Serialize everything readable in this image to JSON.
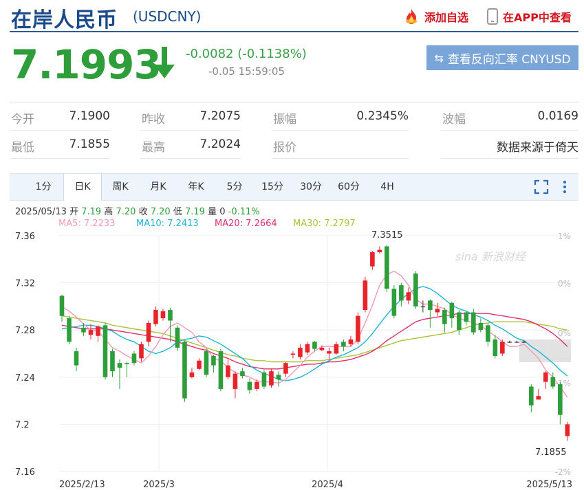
{
  "header": {
    "title": "在岸人民币",
    "symbol": "(USDCNY)",
    "add_watch": "添加自选",
    "app_view": "在APP中查看"
  },
  "quote": {
    "price": "7.1993",
    "change": "-0.0082 (-0.1138%)",
    "time": "-0.05 15:59:05",
    "reverse_button": "查看反向汇率 CNYUSD",
    "down_color": "#2e9e3a",
    "up_color": "#e8232a"
  },
  "stats": {
    "open_label": "今开",
    "open": "7.1900",
    "prev_close_label": "昨收",
    "prev_close": "7.2075",
    "amplitude_label": "振幅",
    "amplitude": "0.2345%",
    "volatility_label": "波幅",
    "volatility": "0.0169",
    "low_label": "最低",
    "low": "7.1855",
    "high_label": "最高",
    "high": "7.2024",
    "quote_label": "报价",
    "quote_val": "",
    "source": "数据来源于倚天"
  },
  "tabs": [
    "1分",
    "日K",
    "周K",
    "月K",
    "年K",
    "5分",
    "15分",
    "30分",
    "60分",
    "4H"
  ],
  "active_tab": "日K",
  "chart_info": {
    "date": "2025/05/13",
    "open_label": "开",
    "open": "7.19",
    "high_label": "高",
    "high": "7.20",
    "close_label": "收",
    "close": "7.20",
    "low_label": "低",
    "low": "7.19",
    "vol_label": "量",
    "vol": "0",
    "pct": "-0.11%",
    "ma5": "MA5: 7.2233",
    "ma10": "MA10: 7.2413",
    "ma20": "MA20: 7.2664",
    "ma30": "MA30: 7.2797",
    "ma5_color": "#f29bb5",
    "ma10_color": "#1eb3d6",
    "ma20_color": "#e0306a",
    "ma30_color": "#a8c23a"
  },
  "watermark": "新浪财经",
  "chart_data": {
    "type": "candlestick",
    "ylim": [
      7.16,
      7.37
    ],
    "y_ticks": [
      "7.36",
      "7.32",
      "7.28",
      "7.24",
      "7.2",
      "7.16"
    ],
    "right_ticks": [
      "1%",
      "0%",
      "-1%",
      "-2%"
    ],
    "x_labels": [
      "2025/2/13",
      "2025/3",
      "2025/4",
      "2025/5/13"
    ],
    "max_label": "7.3515",
    "min_label": "7.1855",
    "candles": [
      [
        7.309,
        7.292,
        7.31,
        7.287
      ],
      [
        7.29,
        7.27,
        7.292,
        7.268
      ],
      [
        7.262,
        7.25,
        7.265,
        7.245
      ],
      [
        7.282,
        7.278,
        7.286,
        7.275
      ],
      [
        7.276,
        7.28,
        7.285,
        7.272
      ],
      [
        7.275,
        7.283,
        7.284,
        7.27
      ],
      [
        7.284,
        7.24,
        7.286,
        7.238
      ],
      [
        7.262,
        7.245,
        7.264,
        7.24
      ],
      [
        7.252,
        7.248,
        7.255,
        7.23
      ],
      [
        7.252,
        7.251,
        7.253,
        7.24
      ],
      [
        7.26,
        7.252,
        7.262,
        7.25
      ],
      [
        7.256,
        7.268,
        7.27,
        7.253
      ],
      [
        7.27,
        7.286,
        7.288,
        7.266
      ],
      [
        7.285,
        7.297,
        7.3,
        7.283
      ],
      [
        7.29,
        7.296,
        7.298,
        7.288
      ],
      [
        7.297,
        7.288,
        7.299,
        7.27
      ],
      [
        7.282,
        7.265,
        7.284,
        7.262
      ],
      [
        7.27,
        7.222,
        7.271,
        7.219
      ],
      [
        7.24,
        7.244,
        7.248,
        7.239
      ],
      [
        7.247,
        7.254,
        7.256,
        7.246
      ],
      [
        7.262,
        7.242,
        7.264,
        7.24
      ],
      [
        7.258,
        7.25,
        7.259,
        7.244
      ],
      [
        7.262,
        7.23,
        7.264,
        7.228
      ],
      [
        7.24,
        7.25,
        7.255,
        7.238
      ],
      [
        7.23,
        7.243,
        7.245,
        7.222
      ],
      [
        7.245,
        7.241,
        7.248,
        7.239
      ],
      [
        7.236,
        7.229,
        7.239,
        7.226
      ],
      [
        7.23,
        7.236,
        7.238,
        7.228
      ],
      [
        7.244,
        7.232,
        7.246,
        7.23
      ],
      [
        7.233,
        7.245,
        7.247,
        7.231
      ],
      [
        7.242,
        7.238,
        7.245,
        7.232
      ],
      [
        7.243,
        7.252,
        7.253,
        7.24
      ],
      [
        7.259,
        7.26,
        7.262,
        7.256
      ],
      [
        7.257,
        7.265,
        7.268,
        7.255
      ],
      [
        7.261,
        7.268,
        7.27,
        7.259
      ],
      [
        7.27,
        7.264,
        7.271,
        7.262
      ],
      [
        7.263,
        7.265,
        7.267,
        7.262
      ],
      [
        7.26,
        7.262,
        7.265,
        7.255
      ],
      [
        7.26,
        7.268,
        7.27,
        7.259
      ],
      [
        7.27,
        7.266,
        7.272,
        7.262
      ],
      [
        7.268,
        7.272,
        7.275,
        7.266
      ],
      [
        7.27,
        7.292,
        7.295,
        7.268
      ],
      [
        7.297,
        7.322,
        7.325,
        7.295
      ],
      [
        7.334,
        7.346,
        7.347,
        7.331
      ],
      [
        7.346,
        7.348,
        7.351,
        7.345
      ],
      [
        7.351,
        7.315,
        7.352,
        7.312
      ],
      [
        7.315,
        7.292,
        7.318,
        7.29
      ],
      [
        7.318,
        7.305,
        7.32,
        7.3
      ],
      [
        7.305,
        7.312,
        7.316,
        7.302
      ],
      [
        7.328,
        7.3,
        7.33,
        7.298
      ],
      [
        7.3,
        7.3,
        7.305,
        7.295
      ],
      [
        7.305,
        7.297,
        7.306,
        7.282
      ],
      [
        7.295,
        7.298,
        7.303,
        7.292
      ],
      [
        7.297,
        7.285,
        7.299,
        7.278
      ],
      [
        7.303,
        7.29,
        7.304,
        7.282
      ],
      [
        7.295,
        7.28,
        7.297,
        7.276
      ],
      [
        7.295,
        7.287,
        7.296,
        7.284
      ],
      [
        7.295,
        7.278,
        7.298,
        7.276
      ],
      [
        7.286,
        7.28,
        7.29,
        7.278
      ],
      [
        7.284,
        7.27,
        7.286,
        7.266
      ],
      [
        7.272,
        7.258,
        7.276,
        7.256
      ],
      [
        7.26,
        7.27,
        7.272,
        7.258
      ],
      [
        7.27,
        7.27,
        7.271,
        7.269
      ],
      [
        7.27,
        7.27,
        7.271,
        7.269
      ],
      [
        7.27,
        7.27,
        7.271,
        7.269
      ],
      [
        7.232,
        7.216,
        7.234,
        7.21
      ],
      [
        7.221,
        7.224,
        7.23,
        7.222
      ],
      [
        7.236,
        7.244,
        7.245,
        7.23
      ],
      [
        7.24,
        7.232,
        7.244,
        7.23
      ],
      [
        7.234,
        7.208,
        7.236,
        7.2
      ],
      [
        7.19,
        7.2,
        7.202,
        7.186
      ]
    ],
    "ma5": [
      7.3,
      7.296,
      7.291,
      7.285,
      7.28,
      7.279,
      7.272,
      7.265,
      7.262,
      7.258,
      7.255,
      7.252,
      7.258,
      7.266,
      7.276,
      7.283,
      7.286,
      7.282,
      7.278,
      7.27,
      7.265,
      7.256,
      7.254,
      7.248,
      7.244,
      7.242,
      7.24,
      7.237,
      7.236,
      7.236,
      7.235,
      7.238,
      7.244,
      7.25,
      7.257,
      7.262,
      7.266,
      7.266,
      7.266,
      7.266,
      7.266,
      7.272,
      7.286,
      7.301,
      7.318,
      7.327,
      7.33,
      7.326,
      7.318,
      7.306,
      7.302,
      7.302,
      7.3,
      7.298,
      7.293,
      7.29,
      7.288,
      7.286,
      7.284,
      7.279,
      7.275,
      7.27,
      7.266,
      7.266,
      7.268,
      7.262,
      7.256,
      7.246,
      7.24,
      7.232,
      7.223
    ],
    "ma10": [
      7.281,
      7.282,
      7.283,
      7.284,
      7.284,
      7.283,
      7.281,
      7.279,
      7.275,
      7.272,
      7.27,
      7.266,
      7.262,
      7.26,
      7.262,
      7.265,
      7.27,
      7.272,
      7.273,
      7.275,
      7.274,
      7.271,
      7.268,
      7.264,
      7.26,
      7.256,
      7.25,
      7.246,
      7.243,
      7.241,
      7.238,
      7.237,
      7.238,
      7.24,
      7.243,
      7.247,
      7.251,
      7.254,
      7.257,
      7.259,
      7.262,
      7.265,
      7.27,
      7.277,
      7.285,
      7.293,
      7.3,
      7.306,
      7.311,
      7.315,
      7.317,
      7.315,
      7.311,
      7.306,
      7.301,
      7.298,
      7.296,
      7.293,
      7.291,
      7.288,
      7.284,
      7.281,
      7.277,
      7.273,
      7.271,
      7.266,
      7.262,
      7.257,
      7.252,
      7.246,
      7.241
    ],
    "ma20": [
      7.284,
      7.283,
      7.282,
      7.281,
      7.281,
      7.281,
      7.281,
      7.28,
      7.279,
      7.278,
      7.277,
      7.276,
      7.275,
      7.274,
      7.273,
      7.272,
      7.27,
      7.268,
      7.266,
      7.264,
      7.263,
      7.26,
      7.258,
      7.256,
      7.253,
      7.251,
      7.249,
      7.248,
      7.247,
      7.247,
      7.247,
      7.248,
      7.249,
      7.25,
      7.251,
      7.251,
      7.252,
      7.253,
      7.253,
      7.254,
      7.255,
      7.257,
      7.259,
      7.262,
      7.266,
      7.271,
      7.275,
      7.279,
      7.283,
      7.287,
      7.289,
      7.29,
      7.291,
      7.292,
      7.293,
      7.294,
      7.294,
      7.294,
      7.294,
      7.294,
      7.293,
      7.292,
      7.291,
      7.29,
      7.289,
      7.287,
      7.284,
      7.281,
      7.277,
      7.272,
      7.266
    ],
    "ma30": [
      7.292,
      7.291,
      7.29,
      7.289,
      7.288,
      7.287,
      7.286,
      7.284,
      7.283,
      7.282,
      7.281,
      7.28,
      7.279,
      7.278,
      7.277,
      7.275,
      7.273,
      7.271,
      7.269,
      7.267,
      7.265,
      7.263,
      7.261,
      7.259,
      7.258,
      7.256,
      7.255,
      7.254,
      7.254,
      7.253,
      7.253,
      7.253,
      7.253,
      7.253,
      7.254,
      7.254,
      7.254,
      7.255,
      7.256,
      7.257,
      7.258,
      7.259,
      7.261,
      7.263,
      7.265,
      7.267,
      7.269,
      7.271,
      7.272,
      7.273,
      7.274,
      7.275,
      7.276,
      7.277,
      7.278,
      7.28,
      7.282,
      7.284,
      7.285,
      7.286,
      7.287,
      7.287,
      7.287,
      7.287,
      7.287,
      7.286,
      7.285,
      7.284,
      7.283,
      7.281,
      7.28
    ]
  }
}
